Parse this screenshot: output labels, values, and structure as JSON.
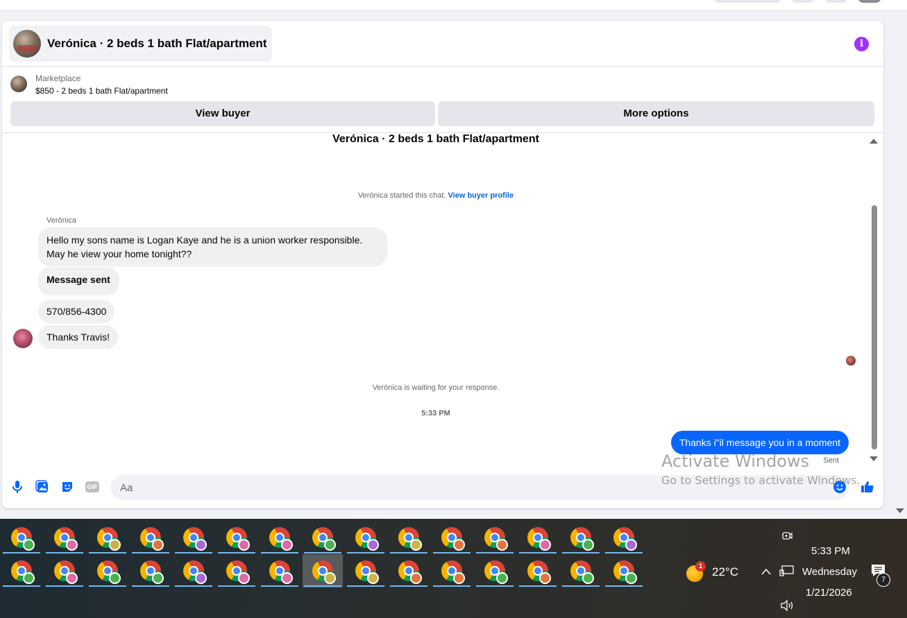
{
  "header": {
    "title": "Verónica · 2 beds 1 bath Flat/apartment",
    "info_icon": "info-icon"
  },
  "marketplace": {
    "label": "Marketplace",
    "listing": "$850 - 2 beds 1 bath Flat/apartment",
    "view_buyer": "View buyer",
    "more_options": "More options"
  },
  "conversation": {
    "listing_title": "Verónica · 2 beds 1 bath Flat/apartment",
    "started_text": "Verónica started this chat.",
    "started_link": "View buyer profile",
    "sender_name": "Verónica",
    "incoming": [
      "Hello my sons name is Logan Kaye and he is a union worker responsible.",
      "May he view your home tonight??",
      "Message sent",
      "570/856-4300",
      "Thanks Travis!"
    ],
    "waiting_text": "Verónica is waiting for your response.",
    "timestamp": "5:33 PM",
    "outgoing": "Thanks i\"il message you in a moment",
    "status": "Sent"
  },
  "composer": {
    "placeholder": "Aa",
    "gif_label": "GIF"
  },
  "watermark": {
    "line1": "Activate Windows",
    "line2": "Go to Settings to activate Windows."
  },
  "taskbar": {
    "app_icon": "chrome-profile-icon",
    "profile_colors_row1": [
      "#4caf50",
      "#e06aa8",
      "#c9b24a",
      "#e0743c",
      "#a66ad8",
      "#e06aa8",
      "#e06aa8",
      "#4caf50",
      "#a66ad8",
      "#d0b34a",
      "#e0743c",
      "#e0743c",
      "#e06aa8",
      "#4caf50",
      "#a66ad8"
    ],
    "profile_colors_row2": [
      "#4caf50",
      "#e06aa8",
      "#4caf50",
      "#4caf50",
      "#a66ad8",
      "#e06aa8",
      "#e06aa8",
      "#c9b24a",
      "#d0b34a",
      "#e0743c",
      "#e0743c",
      "#4caf50",
      "#e0743c",
      "#4caf50",
      "#4caf50"
    ],
    "temperature": "22°C",
    "weather_badge": "1",
    "time": "5:33 PM",
    "day": "Wednesday",
    "date": "1/21/2026",
    "notification_count": "7"
  },
  "colors": {
    "accent": "#0866ff",
    "info": "#a033ff"
  }
}
